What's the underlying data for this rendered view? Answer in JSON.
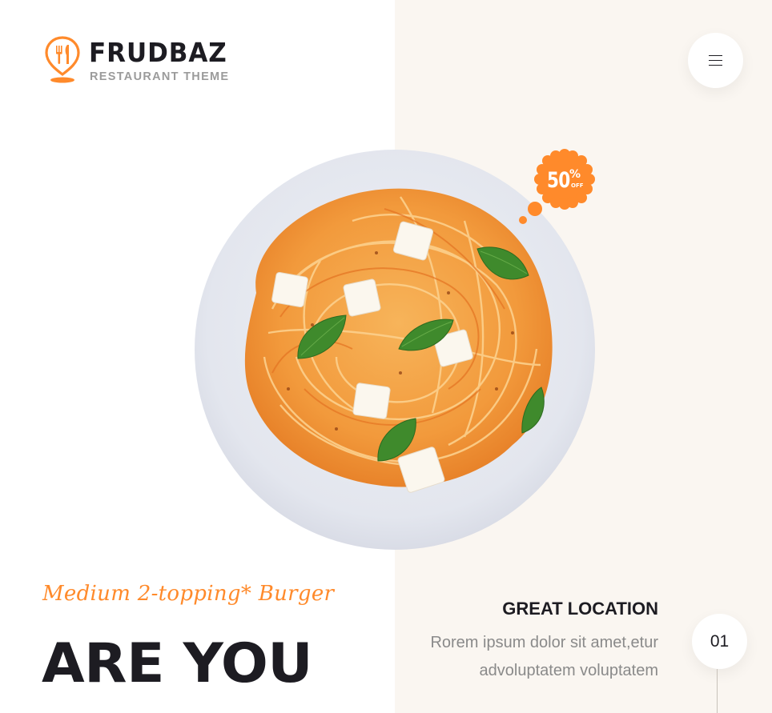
{
  "brand": {
    "name": "FRUDBAZ",
    "tagline": "RESTAURANT THEME",
    "icon": "location-pin-cutlery-icon",
    "accent_color": "#ff8a2b"
  },
  "header": {
    "menu_icon": "hamburger-menu-icon"
  },
  "hero": {
    "image": "spaghetti-plate-illustration",
    "badge": {
      "value": "50",
      "percent": "%",
      "off": "OFF"
    },
    "subtitle": "Medium 2-topping* Burger",
    "headline": "ARE YOU"
  },
  "feature": {
    "title": "GREAT LOCATION",
    "description": "Rorem ipsum dolor sit amet,etur advoluptatem voluptatem",
    "step_number": "01"
  },
  "colors": {
    "right_panel_bg": "#faf6f1",
    "text_dark": "#1d1c22",
    "text_muted": "#8a8a8a"
  }
}
